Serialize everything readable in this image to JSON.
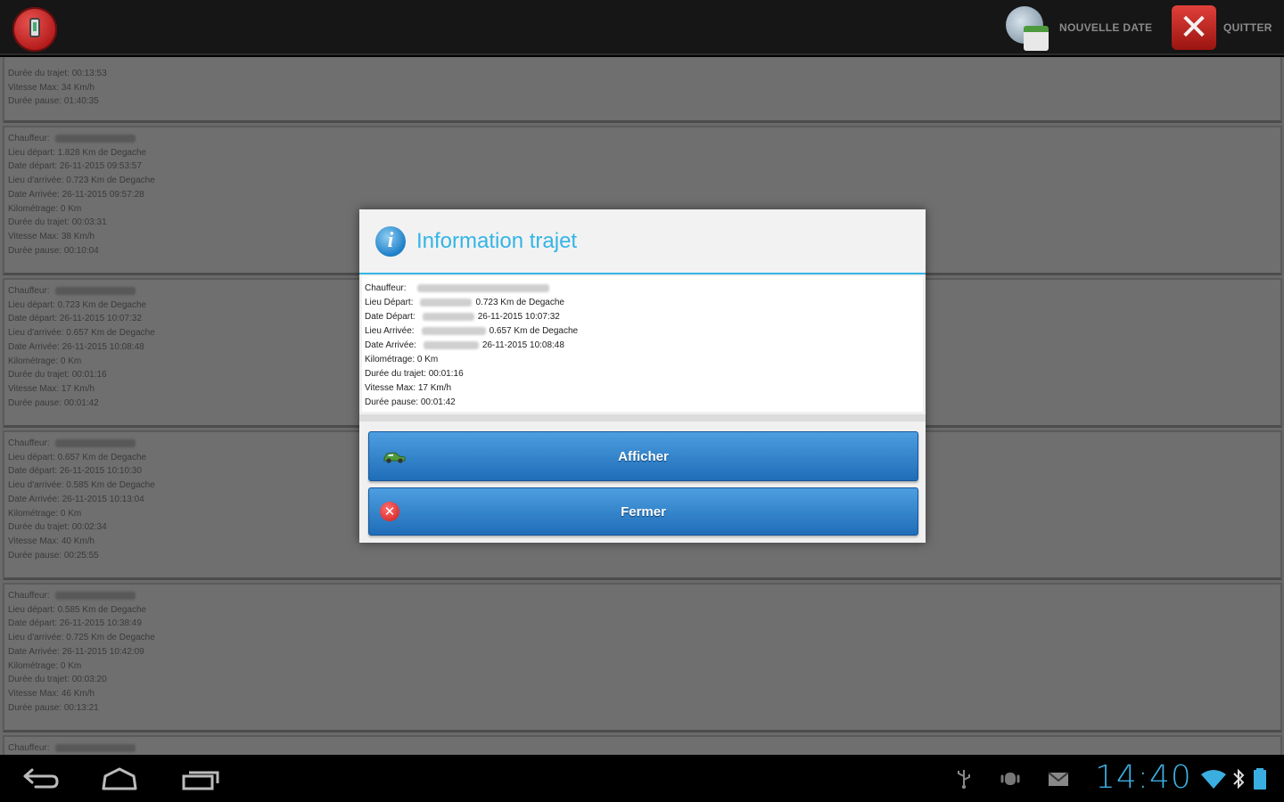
{
  "action_bar": {
    "new_date_label": "NOUVELLE DATE",
    "quit_label": "QUITTER",
    "accent": "#161616"
  },
  "trips": [
    {
      "lines": [
        "Durée du trajet: 00:13:53",
        "Vitesse Max: 34 Km/h",
        "Durée pause: 01:40:35"
      ]
    },
    {
      "lines": [
        "Chauffeur:",
        "Lieu départ: 1.828 Km de Degache",
        "Date départ: 26-11-2015 09:53:57",
        "Lieu d'arrivée: 0.723 Km de Degache",
        "Date Arrivée: 26-11-2015 09:57:28",
        "Kilométrage: 0 Km",
        "Durée du trajet: 00:03:31",
        "Vitesse Max: 38 Km/h",
        "Durée pause: 00:10:04"
      ]
    },
    {
      "lines": [
        "Chauffeur:",
        "Lieu départ: 0.723 Km de Degache",
        "Date départ: 26-11-2015 10:07:32",
        "Lieu d'arrivée: 0.657 Km de Degache",
        "Date Arrivée: 26-11-2015 10:08:48",
        "Kilométrage: 0 Km",
        "Durée du trajet: 00:01:16",
        "Vitesse Max: 17 Km/h",
        "Durée pause: 00:01:42"
      ]
    },
    {
      "lines": [
        "Chauffeur:",
        "Lieu départ: 0.657 Km de Degache",
        "Date départ: 26-11-2015 10:10:30",
        "Lieu d'arrivée: 0.585 Km de Degache",
        "Date Arrivée: 26-11-2015 10:13:04",
        "Kilométrage: 0 Km",
        "Durée du trajet: 00:02:34",
        "Vitesse Max: 40 Km/h",
        "Durée pause: 00:25:55"
      ]
    },
    {
      "lines": [
        "Chauffeur:",
        "Lieu départ: 0.585 Km de Degache",
        "Date départ: 26-11-2015 10:38:49",
        "Lieu d'arrivée: 0.725 Km de Degache",
        "Date Arrivée: 26-11-2015 10:42:09",
        "Kilométrage: 0 Km",
        "Durée du trajet: 00:03:20",
        "Vitesse Max: 46 Km/h",
        "Durée pause: 00:13:21"
      ]
    },
    {
      "lines": [
        "Chauffeur:"
      ]
    }
  ],
  "dialog": {
    "title": "Information trajet",
    "title_color": "#33b5e5",
    "info": {
      "driver": "Chauffeur:",
      "start_place_label": "Lieu Départ:",
      "start_place_value": "0.723 Km de Degache",
      "start_date_label": "Date Départ:",
      "start_date_value": "26-11-2015 10:07:32",
      "end_place_label": "Lieu Arrivée:",
      "end_place_value": "0.657 Km de Degache",
      "end_date_label": "Date Arrivée:",
      "end_date_value": "26-11-2015 10:08:48",
      "mileage": "Kilométrage: 0 Km",
      "duration": "Durée du trajet: 00:01:16",
      "max_speed": "Vitesse Max: 17 Km/h",
      "pause": "Durée pause: 00:01:42"
    },
    "show_button": "Afficher",
    "close_button": "Fermer",
    "button_color": "#2a7fcc"
  },
  "system_bar": {
    "clock": "14:40",
    "clock_color": "#3aaee0"
  }
}
